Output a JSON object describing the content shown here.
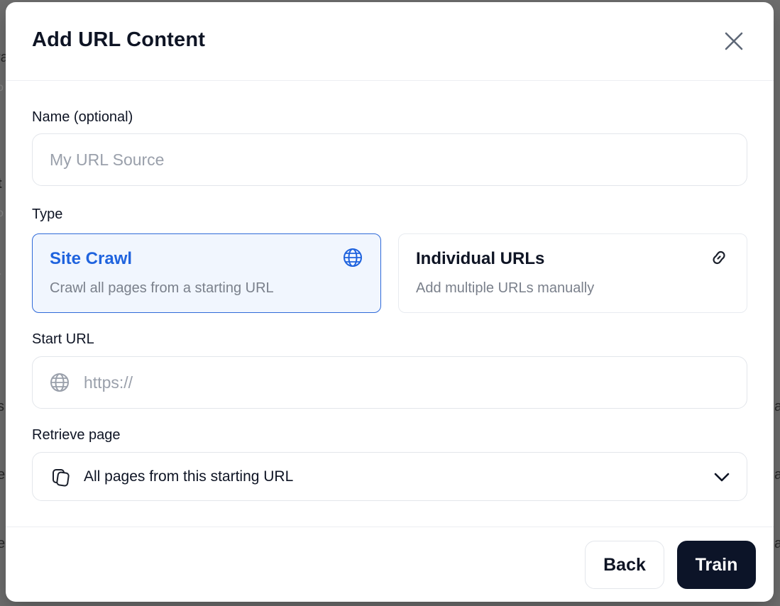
{
  "modal": {
    "title": "Add URL Content"
  },
  "name_field": {
    "label": "Name (optional)",
    "value": "",
    "placeholder": "My URL Source"
  },
  "type_field": {
    "label": "Type",
    "options": [
      {
        "title": "Site Crawl",
        "description": "Crawl all pages from a starting URL",
        "icon": "globe-icon",
        "selected": true
      },
      {
        "title": "Individual URLs",
        "description": "Add multiple URLs manually",
        "icon": "link-icon",
        "selected": false
      }
    ]
  },
  "start_url_field": {
    "label": "Start URL",
    "value": "",
    "placeholder": "https://",
    "icon": "globe-icon"
  },
  "retrieve_field": {
    "label": "Retrieve page",
    "selected_value": "All pages from this starting URL",
    "icon": "copy-pages-icon"
  },
  "footer": {
    "back_label": "Back",
    "train_label": "Train"
  },
  "colors": {
    "accent": "#1f63de",
    "primary_button": "#0c1428",
    "selected_card_bg": "#f1f6fe"
  }
}
